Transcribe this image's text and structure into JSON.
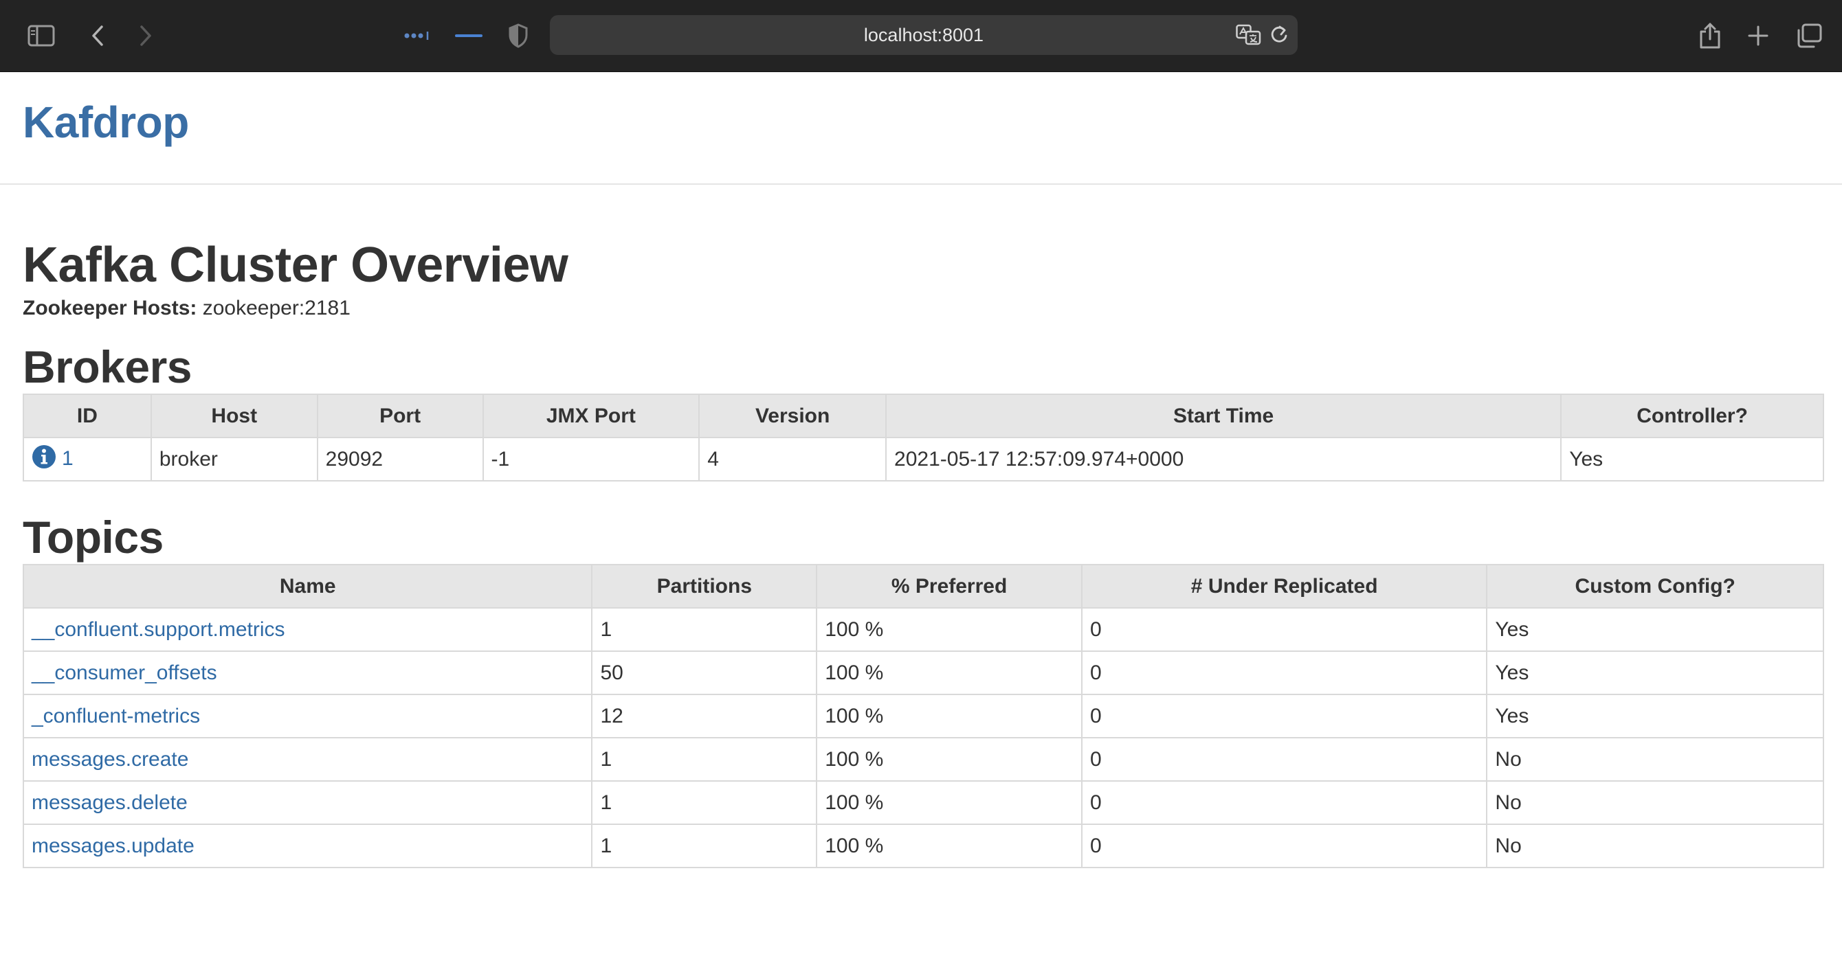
{
  "browser": {
    "url": "localhost:8001"
  },
  "app": {
    "brand": "Kafdrop"
  },
  "overview": {
    "title": "Kafka Cluster Overview",
    "zookeeper_label": "Zookeeper Hosts:",
    "zookeeper_value": "zookeeper:2181"
  },
  "brokers": {
    "title": "Brokers",
    "columns": [
      "ID",
      "Host",
      "Port",
      "JMX Port",
      "Version",
      "Start Time",
      "Controller?"
    ],
    "rows": [
      {
        "id": "1",
        "host": "broker",
        "port": "29092",
        "jmx_port": "-1",
        "version": "4",
        "start_time": "2021-05-17 12:57:09.974+0000",
        "controller": "Yes"
      }
    ]
  },
  "topics": {
    "title": "Topics",
    "columns": [
      "Name",
      "Partitions",
      "% Preferred",
      "# Under Replicated",
      "Custom Config?"
    ],
    "rows": [
      {
        "name": "__confluent.support.metrics",
        "partitions": "1",
        "preferred": "100 %",
        "under_replicated": "0",
        "custom_config": "Yes"
      },
      {
        "name": "__consumer_offsets",
        "partitions": "50",
        "preferred": "100 %",
        "under_replicated": "0",
        "custom_config": "Yes"
      },
      {
        "name": "_confluent-metrics",
        "partitions": "12",
        "preferred": "100 %",
        "under_replicated": "0",
        "custom_config": "Yes"
      },
      {
        "name": "messages.create",
        "partitions": "1",
        "preferred": "100 %",
        "under_replicated": "0",
        "custom_config": "No"
      },
      {
        "name": "messages.delete",
        "partitions": "1",
        "preferred": "100 %",
        "under_replicated": "0",
        "custom_config": "No"
      },
      {
        "name": "messages.update",
        "partitions": "1",
        "preferred": "100 %",
        "under_replicated": "0",
        "custom_config": "No"
      }
    ]
  },
  "colors": {
    "link": "#2f6aa5",
    "brand": "#3a6ea5",
    "header_bg": "#e6e6e6",
    "toolbar_bg": "#232323"
  },
  "icons": {
    "sidebar": "sidebar-icon",
    "back": "back-arrow-icon",
    "forward": "forward-arrow-icon",
    "tab_overview": "tab-overview-icon",
    "tab_indicator": "tab-indicator-icon",
    "privacy": "shield-icon",
    "translate": "translate-icon",
    "reload": "reload-icon",
    "share": "share-icon",
    "new_tab": "plus-icon",
    "tabs": "tabs-icon",
    "broker_info": "info-icon"
  }
}
